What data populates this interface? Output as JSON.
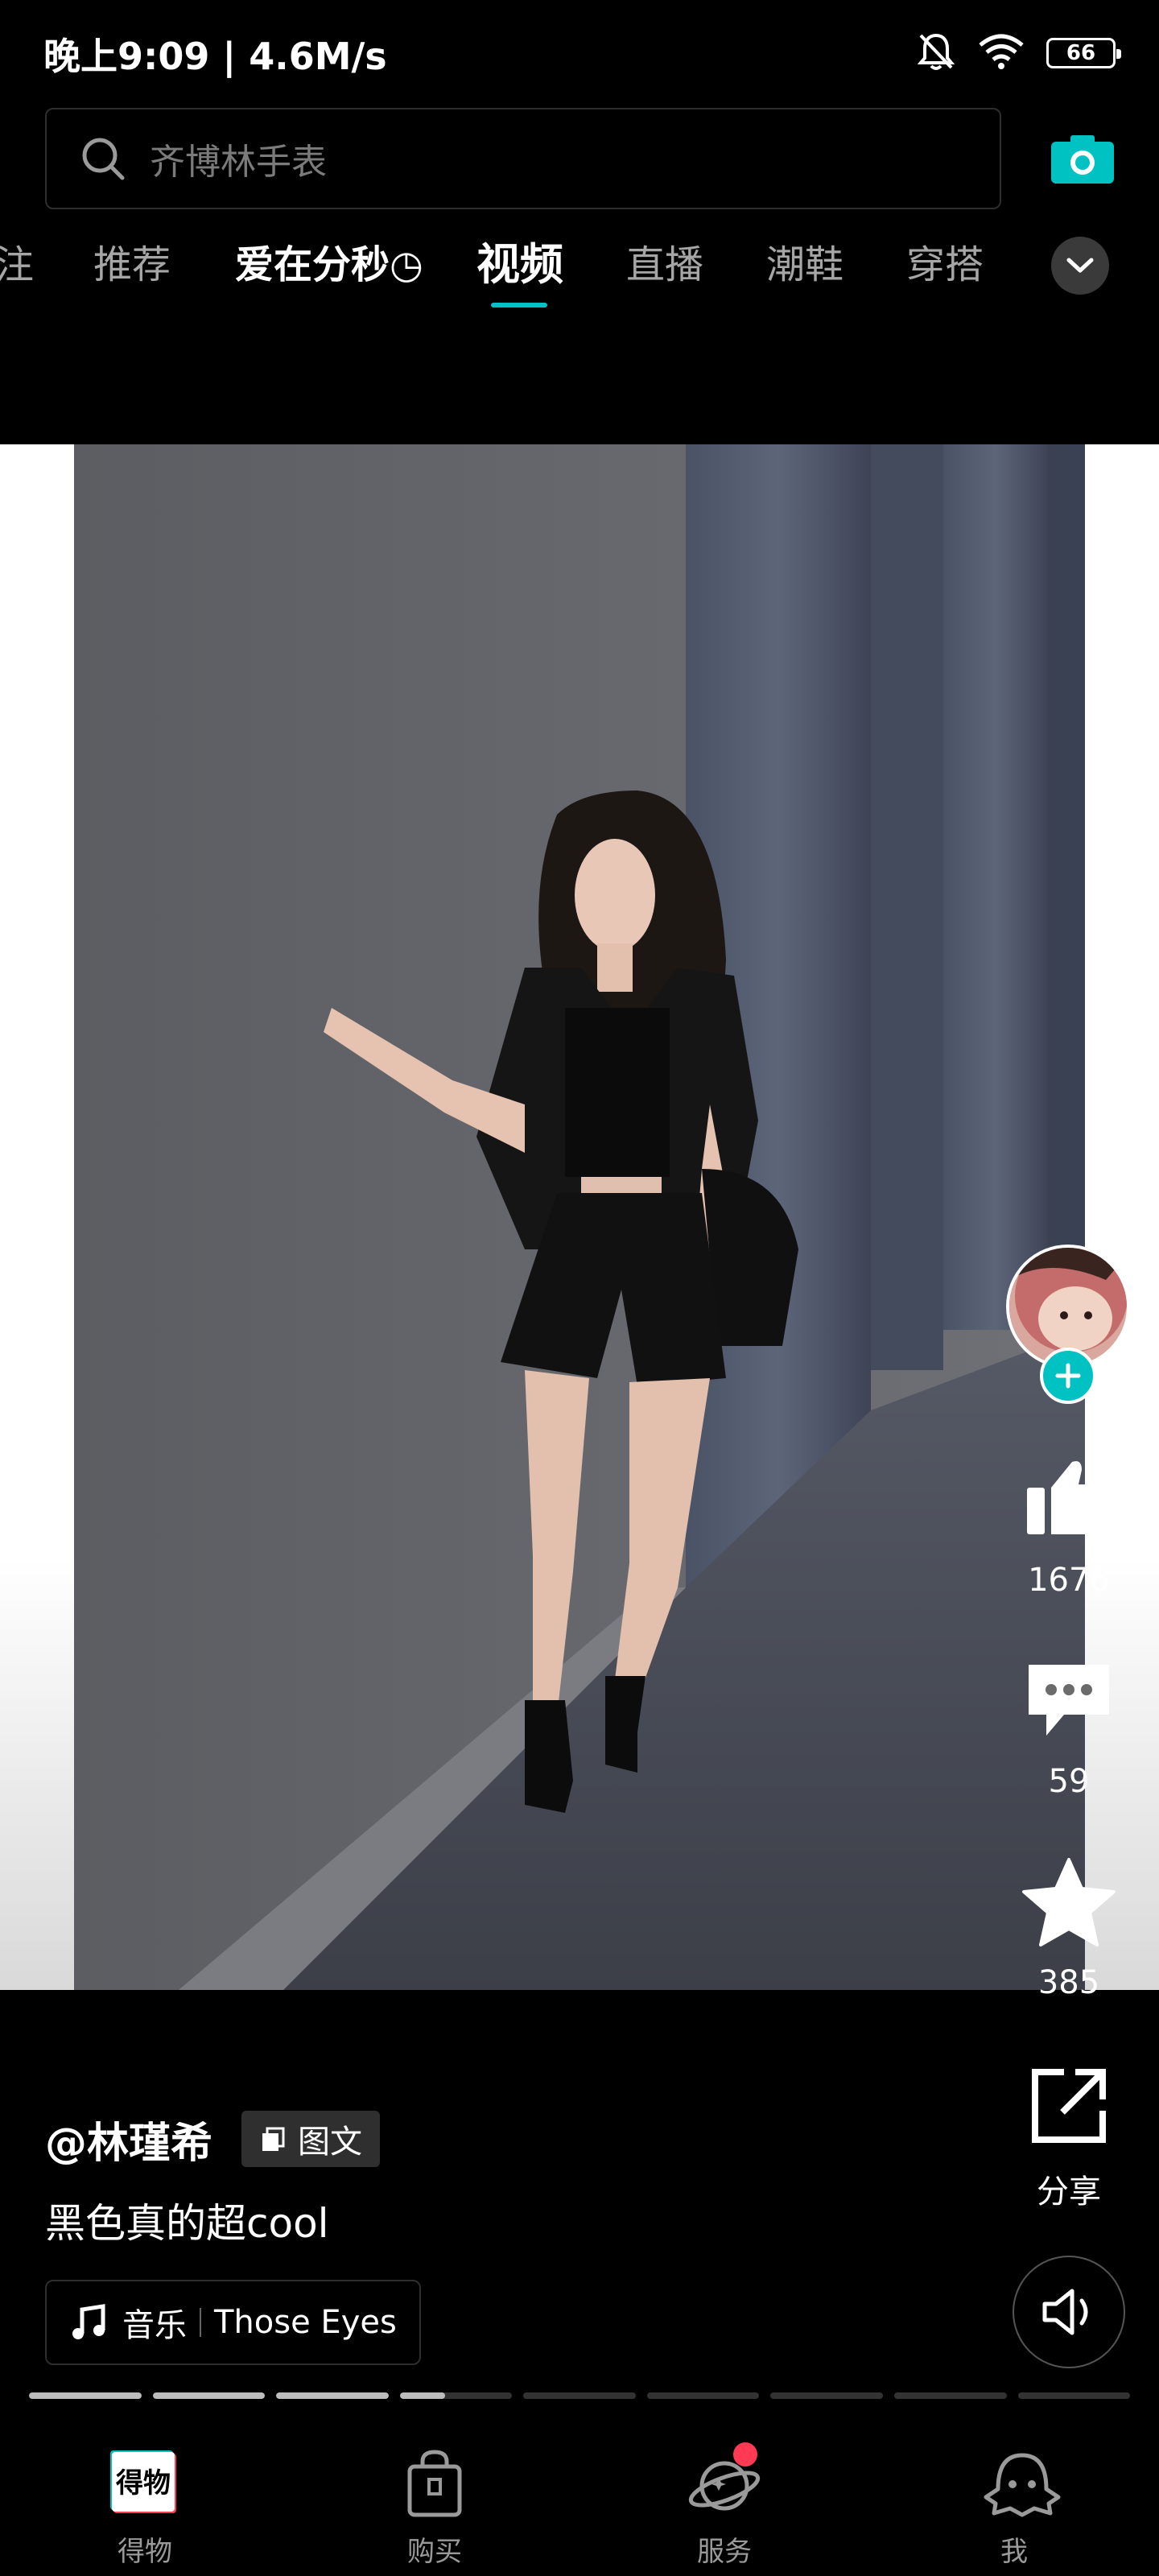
{
  "status_bar": {
    "time_speed": "晚上9:09 | 4.6M/s",
    "battery": "66"
  },
  "search": {
    "placeholder": "齐博林手表"
  },
  "tabs": [
    {
      "label": "注"
    },
    {
      "label": "推荐"
    },
    {
      "label": "爱在分秒◷"
    },
    {
      "label": "视频"
    },
    {
      "label": "直播"
    },
    {
      "label": "潮鞋"
    },
    {
      "label": "穿搭"
    }
  ],
  "active_tab": "视频",
  "accent_color": "#01c2c3",
  "actions": {
    "likes": "1676",
    "comments": "59",
    "favorites": "385",
    "share_label": "分享"
  },
  "post": {
    "author": "@林瑾希",
    "type_badge": "图文",
    "caption": "黑色真的超cool",
    "music_label": "音乐",
    "music_title": "Those Eyes"
  },
  "progress": {
    "segments": 9,
    "current_index": 3,
    "current_fraction": 0.4
  },
  "bottom_nav": [
    {
      "label": "得物",
      "icon": "dewu-logo-icon"
    },
    {
      "label": "购买",
      "icon": "shopping-bag-icon"
    },
    {
      "label": "服务",
      "icon": "planet-icon"
    },
    {
      "label": "我",
      "icon": "alien-face-icon"
    }
  ]
}
